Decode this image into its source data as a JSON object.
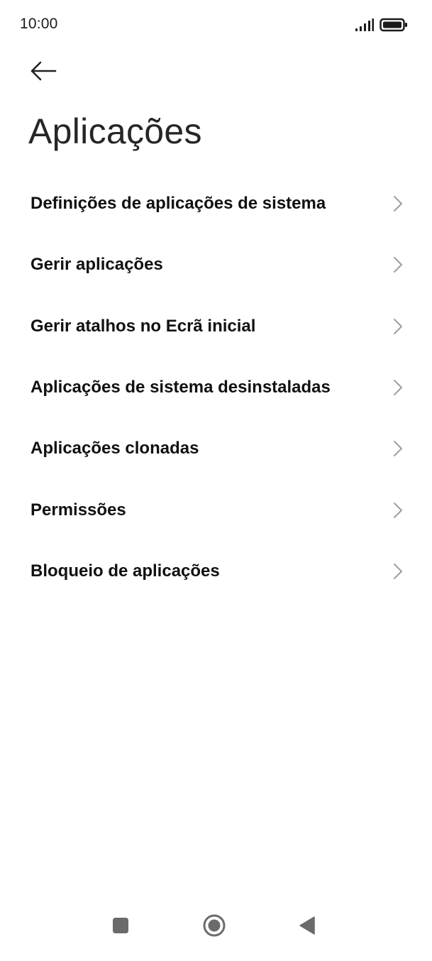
{
  "status_bar": {
    "time": "10:00",
    "signal_icon": "signal-icon",
    "battery_icon": "battery-icon"
  },
  "header": {
    "back_icon": "arrow-left-icon",
    "title": "Aplicações"
  },
  "menu": {
    "items": [
      {
        "label": "Definições de aplicações de sistema"
      },
      {
        "label": "Gerir aplicações"
      },
      {
        "label": "Gerir atalhos no Ecrã inicial"
      },
      {
        "label": "Aplicações de sistema desinstaladas"
      },
      {
        "label": "Aplicações clonadas"
      },
      {
        "label": "Permissões"
      },
      {
        "label": "Bloqueio de aplicações"
      }
    ],
    "chevron_icon": "chevron-right-icon"
  },
  "nav_bar": {
    "recents_icon": "square-icon",
    "home_icon": "circle-home-icon",
    "back_icon": "triangle-back-icon"
  },
  "colors": {
    "background": "#ffffff",
    "text": "#111111",
    "title": "#262626",
    "chevron": "#9e9e9e",
    "nav_icons": "#6b6b6b"
  }
}
